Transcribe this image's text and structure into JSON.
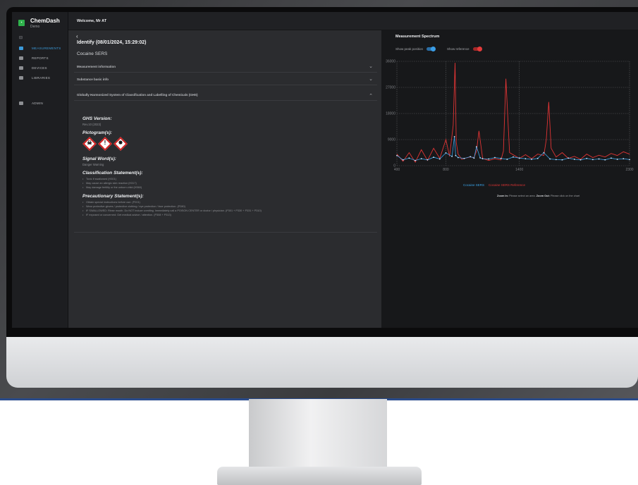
{
  "app": {
    "name": "ChemDash",
    "subtitle": "Demo"
  },
  "header": {
    "welcome": "Welcome, Mr AT"
  },
  "sidebar": {
    "items": [
      {
        "label": "MEASUREMENTS",
        "active": true,
        "icon": "measurements-icon"
      },
      {
        "label": "REPORTS",
        "icon": "reports-icon"
      },
      {
        "label": "DEVICES",
        "icon": "devices-icon"
      },
      {
        "label": "LIBRARIES",
        "icon": "libraries-icon"
      }
    ],
    "admin": {
      "label": "ADMIN",
      "icon": "admin-lock-icon"
    }
  },
  "result": {
    "back": "‹",
    "title": "Identify  (08/01/2024, 15:29:02)",
    "sample": "Cocaine SERS"
  },
  "sections": {
    "measurement_info": "Measurement information",
    "substance_info": "Substance basic info",
    "ghs": "Globally Harmonized System of Classification and Labelling of Chemicals (GHS)"
  },
  "ghs": {
    "version_heading": "GHS Version:",
    "version": "Rev.10 (2023)",
    "pictogram_heading": "Pictogram(s):",
    "pictograms": [
      {
        "icon": "skull-crossbones-icon",
        "glyph": "☠"
      },
      {
        "icon": "exclamation-mark-icon",
        "glyph": "!"
      },
      {
        "icon": "health-hazard-icon",
        "glyph": "✸"
      }
    ],
    "signal_heading": "Signal Word(s):",
    "signal": "Danger  Warning",
    "classification_heading": "Classification Statement(s):",
    "classification": [
      "Toxic if swallowed (H301)",
      "May cause an allergic skin reaction (H317)",
      "May damage fertility or the unborn child (H360)"
    ],
    "precautionary_heading": "Precautionary Statement(s):",
    "precautionary": [
      "Obtain special instructions before use. (P201)",
      "Wear protective gloves / protective clothing / eye protection / face protection. (P280)",
      "IF SWALLOWED: Rinse mouth. Do NOT induce vomiting. Immediately call a POISON CENTER or doctor / physician. (P301 + P330 + P331 + P310)",
      "IF exposed or concerned: Get medical advice / attention. (P308 + P313)"
    ]
  },
  "spectrum": {
    "title": "Measurement Spectrum",
    "toggle_peak": "Show peak position",
    "toggle_reference": "Show reference",
    "zoom_in_label": "Zoom In:",
    "zoom_in_text": "Please select an area.",
    "zoom_out_label": "Zoom Out:",
    "zoom_out_text": "Please click on the chart"
  },
  "chart_data": {
    "type": "line",
    "x_ticks": [
      "400",
      "800",
      "1400",
      "2300"
    ],
    "y_ticks": [
      "36000",
      "27000",
      "18000",
      "9000",
      "0"
    ],
    "xlim": [
      400,
      2300
    ],
    "ylim": [
      0,
      36000
    ],
    "grid": true,
    "series": [
      {
        "name": "Cocaine SERS",
        "color": "#3aa3e8",
        "x": [
          400,
          450,
          500,
          550,
          600,
          650,
          700,
          750,
          800,
          850,
          870,
          880,
          900,
          950,
          1000,
          1030,
          1050,
          1080,
          1100,
          1150,
          1200,
          1250,
          1300,
          1350,
          1400,
          1450,
          1500,
          1550,
          1600,
          1650,
          1700,
          1750,
          1800,
          1850,
          1900,
          1950,
          2000,
          2050,
          2100,
          2150,
          2200,
          2250,
          2300
        ],
        "y": [
          3500,
          2000,
          2600,
          1800,
          2400,
          2000,
          2900,
          2300,
          4400,
          3200,
          10000,
          3500,
          2800,
          2500,
          3100,
          2600,
          6500,
          2700,
          2400,
          2300,
          2800,
          2500,
          2200,
          3000,
          2600,
          2400,
          2200,
          2500,
          4500,
          2300,
          2100,
          2000,
          2600,
          2200,
          2000,
          2500,
          2100,
          2300,
          2000,
          2600,
          2200,
          2400,
          2100
        ]
      },
      {
        "name": "Cocaine SERS Reference",
        "color": "#e03434",
        "x": [
          400,
          450,
          500,
          550,
          600,
          650,
          700,
          750,
          800,
          830,
          860,
          875,
          885,
          900,
          930,
          960,
          1000,
          1030,
          1050,
          1070,
          1100,
          1150,
          1200,
          1250,
          1270,
          1290,
          1320,
          1400,
          1450,
          1500,
          1550,
          1600,
          1620,
          1640,
          1660,
          1700,
          1750,
          1800,
          1850,
          1900,
          1950,
          2000,
          2050,
          2100,
          2150,
          2200,
          2250,
          2300
        ],
        "y": [
          4000,
          1500,
          4500,
          1200,
          5500,
          1800,
          6000,
          2500,
          9000,
          3200,
          14000,
          35500,
          8000,
          4000,
          2200,
          2600,
          3000,
          2800,
          5000,
          12000,
          2500,
          1800,
          2400,
          2000,
          5000,
          30000,
          4500,
          2500,
          3800,
          2400,
          4000,
          3500,
          9000,
          22000,
          6000,
          3000,
          4500,
          2500,
          3200,
          2200,
          4000,
          2800,
          3600,
          3000,
          4200,
          3500,
          4800,
          4000
        ]
      }
    ]
  }
}
